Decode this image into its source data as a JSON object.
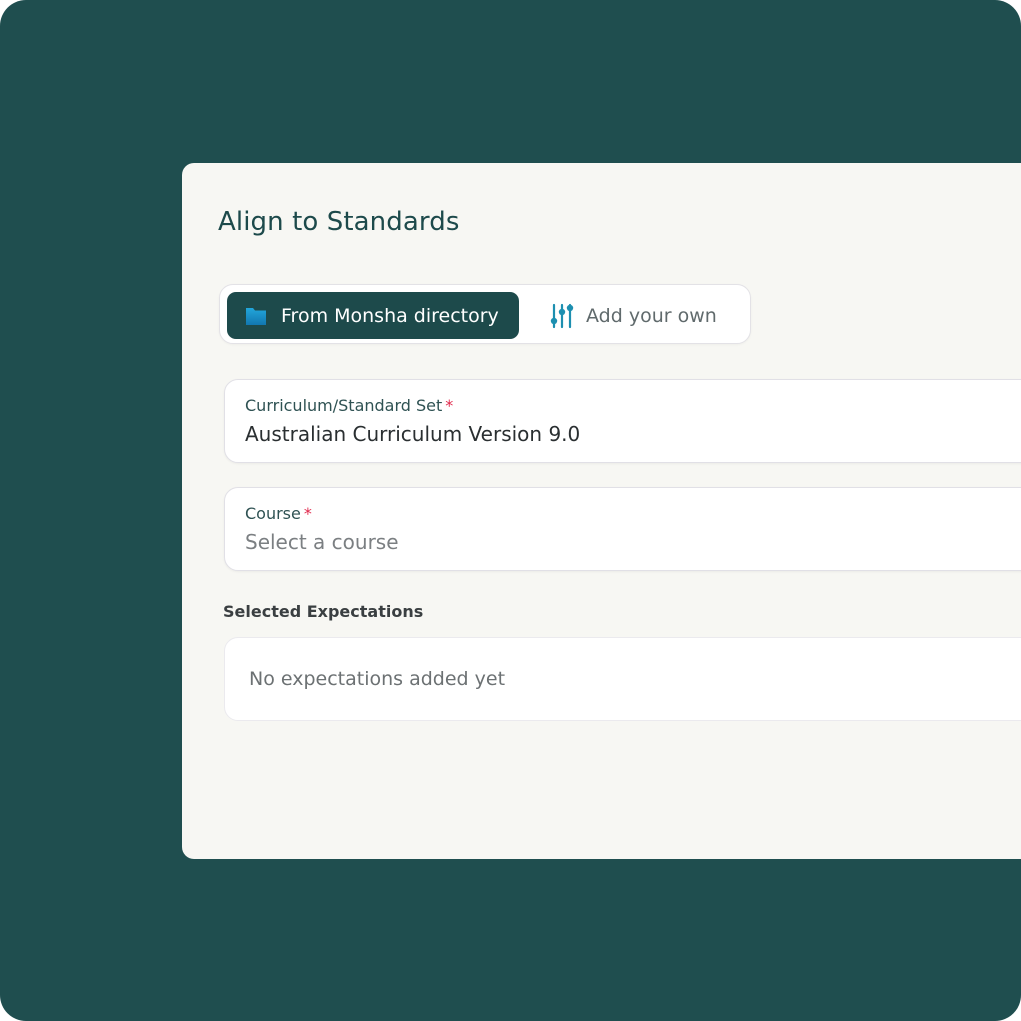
{
  "dialog": {
    "title": "Align to Standards"
  },
  "source_toggle": {
    "selected": "From Monsha directory",
    "options": [
      {
        "label": "From Monsha directory",
        "icon": "folder-icon",
        "active": true
      },
      {
        "label": "Add your own",
        "icon": "sliders-icon",
        "active": false
      }
    ]
  },
  "curriculum_field": {
    "label": "Curriculum/Standard Set",
    "required_mark": "*",
    "value": "Australian Curriculum Version 9.0"
  },
  "course_field": {
    "label": "Course",
    "required_mark": "*",
    "placeholder": "Select a course"
  },
  "expectations": {
    "heading": "Selected Expectations",
    "empty_message": "No expectations added yet"
  },
  "colors": {
    "background": "#1f4e4f",
    "panel": "#f7f7f3",
    "accent": "#1d4a4b",
    "folder_icon": "#1a8fc4",
    "sliders_icon": "#1d8fb0",
    "required": "#e0284b"
  }
}
